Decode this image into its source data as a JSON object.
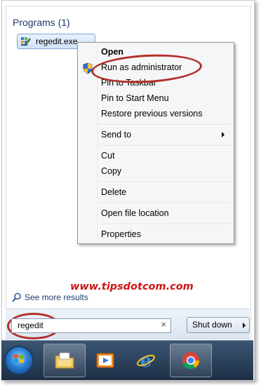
{
  "programs": {
    "title": "Programs (1)",
    "items": [
      {
        "label": "regedit.exe",
        "icon": "regedit-icon"
      }
    ]
  },
  "context_menu": {
    "items": [
      {
        "label": "Open",
        "bold": true
      },
      {
        "label": "Run as administrator",
        "icon": "uac-shield-icon"
      },
      {
        "label": "Pin to Taskbar"
      },
      {
        "label": "Pin to Start Menu"
      },
      {
        "label": "Restore previous versions"
      },
      {
        "label": "Send to",
        "submenu": true
      },
      {
        "label": "Cut"
      },
      {
        "label": "Copy"
      },
      {
        "label": "Delete"
      },
      {
        "label": "Open file location"
      },
      {
        "label": "Properties"
      }
    ]
  },
  "watermark": "www.tipsdotcom.com",
  "see_more": "See more results",
  "search": {
    "value": "regedit",
    "clear_glyph": "×"
  },
  "shutdown": {
    "label": "Shut down"
  },
  "taskbar": {
    "items": [
      {
        "name": "start-orb",
        "icon": "windows-flag-icon"
      },
      {
        "name": "explorer",
        "icon": "folder-icon"
      },
      {
        "name": "media-player",
        "icon": "media-player-icon"
      },
      {
        "name": "internet-explorer",
        "icon": "ie-icon"
      },
      {
        "name": "chrome",
        "icon": "chrome-icon"
      }
    ]
  },
  "colors": {
    "highlight_oval": "#b3302a",
    "watermark": "#d01414",
    "accent_blue": "#1e3a6e"
  }
}
